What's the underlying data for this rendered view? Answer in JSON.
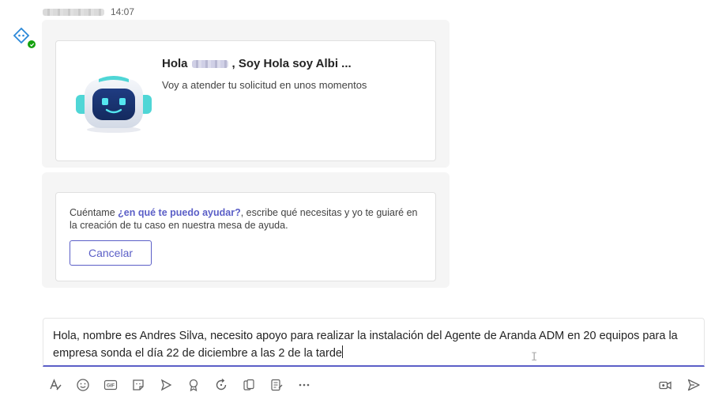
{
  "message": {
    "timestamp": "14:07",
    "sender_icon": "bot-diamond-icon",
    "presence": "available-check-icon"
  },
  "welcome_card": {
    "title_prefix": "Hola",
    "title_suffix": ", Soy Hola soy Albi ...",
    "subtitle": "Voy a atender tu solicitud en unos momentos",
    "image": "robot-mascot-icon"
  },
  "help_card": {
    "text_before": "Cuéntame ",
    "text_bold": "¿en qué te puedo ayudar?",
    "text_after": ", escribe qué necesitas y yo te guiaré en la creación de tu caso en nuestra mesa de ayuda.",
    "cancel_label": "Cancelar"
  },
  "compose": {
    "value": "Hola, nombre es Andres Silva, necesito apoyo para realizar la instalación del Agente de Aranda ADM en 20 equipos para la empresa sonda el día 22 de diciembre a las 2 de la tarde"
  },
  "toolbar": {
    "icons": [
      "format-icon",
      "emoji-icon",
      "gif-icon",
      "sticker-icon",
      "schedule-send-icon",
      "praise-icon",
      "loop-icon",
      "attach-icon",
      "forms-icon",
      "more-icon"
    ],
    "right_icons": [
      "meet-now-icon",
      "send-icon"
    ]
  },
  "colors": {
    "accent": "#5b5fc7",
    "card_bg": "#f5f5f5",
    "presence": "#13a10e"
  }
}
